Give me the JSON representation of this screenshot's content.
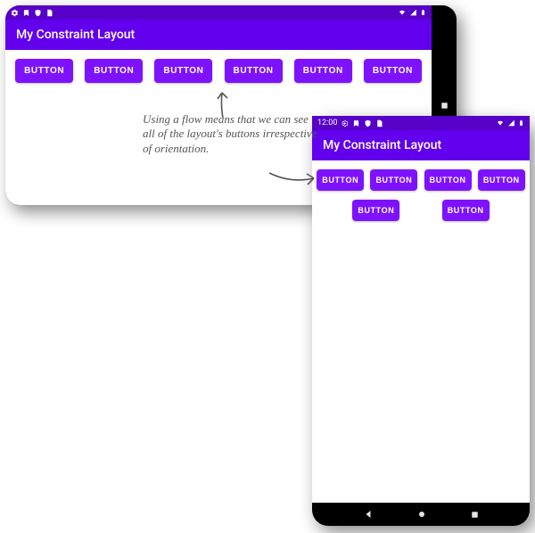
{
  "status_time": "12:00",
  "app_title": "My Constraint Layout",
  "button_label": "BUTTON",
  "annotation_text": "Using a flow means that we can see all of the layout's buttons irrespective of orientation.",
  "accent_color": "#6200ee",
  "button_color": "#7e12ff",
  "status_bar_color": "#5700c7",
  "landscape": {
    "buttons": [
      "BUTTON",
      "BUTTON",
      "BUTTON",
      "BUTTON",
      "BUTTON",
      "BUTTON"
    ]
  },
  "portrait": {
    "buttons": [
      "BUTTON",
      "BUTTON",
      "BUTTON",
      "BUTTON",
      "BUTTON",
      "BUTTON"
    ]
  }
}
